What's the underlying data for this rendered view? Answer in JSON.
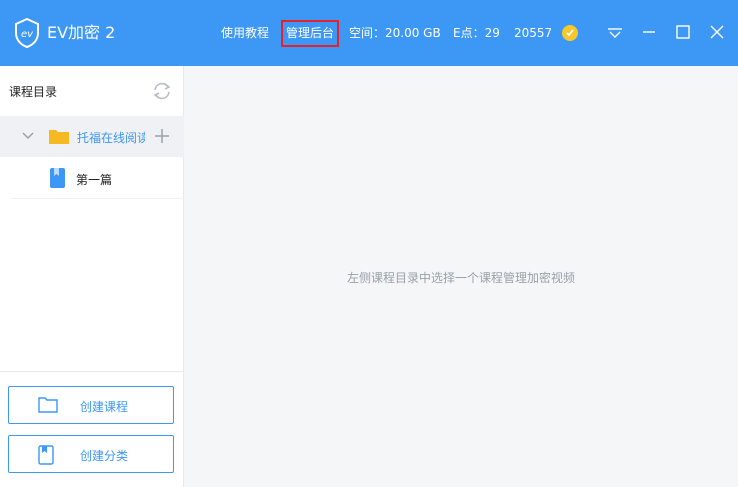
{
  "app": {
    "title": "EV加密 2"
  },
  "header": {
    "tutorial_label": "使用教程",
    "admin_label": "管理后台",
    "space_text": "空间：20.00 GB",
    "epoints_text": "E点：29",
    "user_number": "20557"
  },
  "sidebar": {
    "title": "课程目录",
    "course": {
      "name": "托福在线阅读"
    },
    "chapter": {
      "name": "第一篇"
    },
    "buttons": {
      "create_course": "创建课程",
      "create_category": "创建分类"
    }
  },
  "main": {
    "hint": "左侧课程目录中选择一个课程管理加密视频"
  },
  "colors": {
    "accent": "#3d97f5",
    "highlight_box": "#e8202a",
    "folder": "#f5b921",
    "coin": "#f7c82c"
  },
  "icons": [
    "ev-logo-icon",
    "coin-icon",
    "dropdown-menu-icon",
    "minimize-icon",
    "maximize-icon",
    "close-icon",
    "refresh-icon",
    "chevron-down-icon",
    "folder-icon",
    "plus-icon",
    "book-icon"
  ]
}
